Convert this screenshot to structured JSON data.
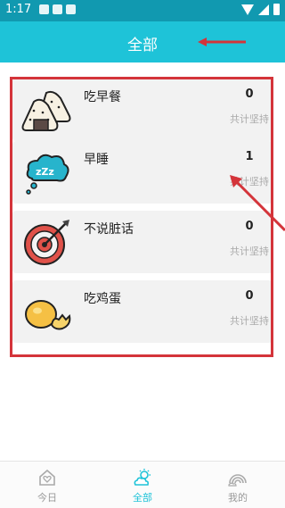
{
  "status_bar": {
    "time": "1:17"
  },
  "app_bar": {
    "title": "全部"
  },
  "habits": [
    {
      "name": "吃早餐",
      "count": "0",
      "sub_label": "共计坚持",
      "icon": "rice-ball-icon"
    },
    {
      "name": "早睡",
      "count": "1",
      "sub_label": "共计坚持",
      "icon": "sleep-cloud-icon"
    },
    {
      "name": "不说脏话",
      "count": "0",
      "sub_label": "共计坚持",
      "icon": "target-icon"
    },
    {
      "name": "吃鸡蛋",
      "count": "0",
      "sub_label": "共计坚持",
      "icon": "egg-icon"
    }
  ],
  "tab_bar": {
    "tabs": [
      {
        "label": "今日",
        "icon": "heart-house-icon",
        "active": false
      },
      {
        "label": "全部",
        "icon": "sun-cloud-icon",
        "active": true
      },
      {
        "label": "我的",
        "icon": "rainbow-icon",
        "active": false
      }
    ]
  },
  "colors": {
    "status_bar": "#1199b0",
    "app_bar": "#1ec3d8",
    "accent": "#1ec3d8",
    "annotation": "#d4343a"
  }
}
